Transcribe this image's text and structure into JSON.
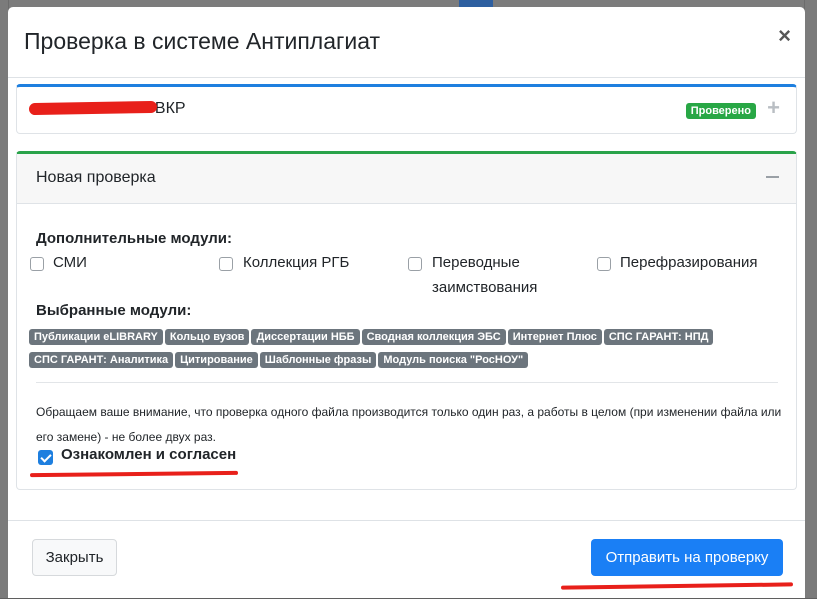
{
  "modal": {
    "title": "Проверка в системе Антиплагиат",
    "close_icon": "×"
  },
  "document_card": {
    "title_suffix": ". ВКР",
    "status_badge": "Проверено",
    "expand_icon": "+"
  },
  "new_check": {
    "title": "Новая проверка",
    "collapse_icon": "minus-icon",
    "additional_modules_label": "Дополнительные модули:",
    "additional_modules": [
      {
        "label": "СМИ",
        "checked": false
      },
      {
        "label": "Коллекция РГБ",
        "checked": false
      },
      {
        "label": "Переводные заимствования",
        "checked": false
      },
      {
        "label": "Перефразирования",
        "checked": false
      }
    ],
    "selected_modules_label": "Выбранные модули:",
    "selected_modules": [
      "Публикации eLIBRARY",
      "Кольцо вузов",
      "Диссертации НББ",
      "Сводная коллекция ЭБС",
      "Интернет Плюс",
      "СПС ГАРАНТ: НПД",
      "СПС ГАРАНТ: Аналитика",
      "Цитирование",
      "Шаблонные фразы",
      "Модуль поиска \"РосНОУ\""
    ],
    "notice": "Обращаем ваше внимание, что проверка одного файла производится только один раз, а работы в целом (при изменении файла или его замене) - не более двух раз.",
    "agree_label": "Ознакомлен и согласен",
    "agree_checked": true
  },
  "footer": {
    "close_label": "Закрыть",
    "submit_label": "Отправить на проверку"
  },
  "colors": {
    "primary": "#1a7ff5",
    "success": "#28a745",
    "chip": "#6c757d",
    "annotation_red": "#e8201a"
  }
}
